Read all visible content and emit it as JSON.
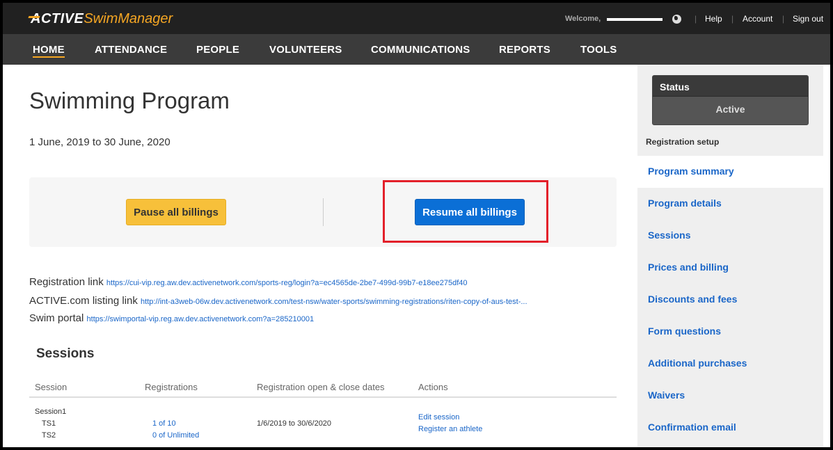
{
  "app": {
    "logo_active": "ACTIVE",
    "logo_product": "SwimManager"
  },
  "topbar": {
    "welcome": "Welcome,",
    "links": [
      "Help",
      "Account",
      "Sign out"
    ]
  },
  "nav": {
    "items": [
      "HOME",
      "ATTENDANCE",
      "PEOPLE",
      "VOLUNTEERS",
      "COMMUNICATIONS",
      "REPORTS",
      "TOOLS"
    ]
  },
  "main": {
    "title": "Swimming Program",
    "date_range": "1 June, 2019 to 30 June, 2020",
    "pause_label": "Pause all billings",
    "resume_label": "Resume all billings",
    "links": [
      {
        "label": "Registration link",
        "url": "https://cui-vip.reg.aw.dev.activenetwork.com/sports-reg/login?a=ec4565de-2be7-499d-99b7-e18ee275df40"
      },
      {
        "label": "ACTIVE.com listing link",
        "url": "http://int-a3web-06w.dev.activenetwork.com/test-nsw/water-sports/swimming-registrations/riten-copy-of-aus-test-..."
      },
      {
        "label": "Swim portal",
        "url": "https://swimportal-vip.reg.aw.dev.activenetwork.com?a=285210001"
      }
    ]
  },
  "sessions": {
    "heading": "Sessions",
    "columns": [
      "Session",
      "Registrations",
      "Registration open & close dates",
      "Actions"
    ],
    "row": {
      "session": "Session1",
      "sub": [
        "TS1",
        "TS2"
      ],
      "registrations": [
        "1 of 10",
        "0 of Unlimited"
      ],
      "dates": "1/6/2019 to 30/6/2020",
      "actions": [
        "Edit session",
        "Register an athlete"
      ]
    }
  },
  "sidebar": {
    "status_title": "Status",
    "status_value": "Active",
    "section_heading": "Registration setup",
    "items": [
      "Program summary",
      "Program details",
      "Sessions",
      "Prices and billing",
      "Discounts and fees",
      "Form questions",
      "Additional purchases",
      "Waivers",
      "Confirmation email"
    ]
  }
}
